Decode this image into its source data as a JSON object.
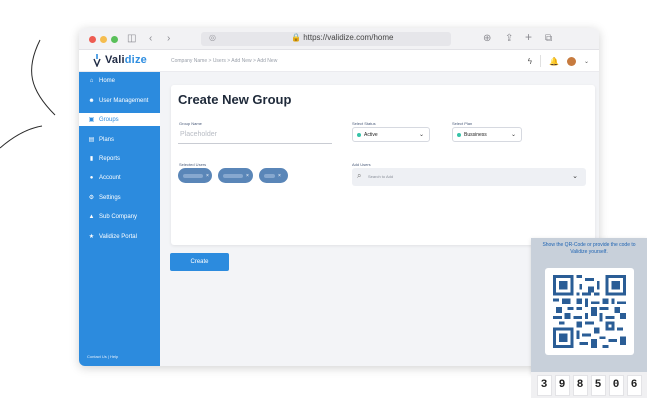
{
  "browser": {
    "url": "https://validize.com/home",
    "icons": {
      "sidebar_toggle": "sidebar-icon",
      "back": "chevron-left-icon",
      "forward": "chevron-right-icon",
      "shield": "shield-icon",
      "lock": "lock-icon",
      "download": "download-icon",
      "share": "share-icon",
      "new_tab": "plus-icon",
      "tabs": "tabs-icon"
    }
  },
  "header": {
    "logo_text_prefix": "Vali",
    "logo_text_accent": "dize",
    "breadcrumb": "Company Name  >  Users  >  Add New  >  Add New",
    "icons": {
      "activity": "activity-icon",
      "bell": "bell-icon",
      "avatar": "avatar",
      "chevron": "chevron-down-icon"
    }
  },
  "sidebar": {
    "items": [
      {
        "label": "Home",
        "icon": "⌂"
      },
      {
        "label": "User Management",
        "icon": "👥"
      },
      {
        "label": "Groups",
        "icon": "▣"
      },
      {
        "label": "Plans",
        "icon": "▤"
      },
      {
        "label": "Reports",
        "icon": "▮"
      },
      {
        "label": "Account",
        "icon": "●"
      },
      {
        "label": "Settings",
        "icon": "⚙"
      },
      {
        "label": "Sub Company",
        "icon": "▲"
      },
      {
        "label": "Validize Portal",
        "icon": "★"
      }
    ],
    "footer": "Contact Us   |   Help"
  },
  "form": {
    "title": "Create New Group",
    "group_name_label": "Group Name",
    "group_name_placeholder": "Placeholder",
    "status_label": "Select Status",
    "status_value": "Active",
    "plan_label": "Select Plan",
    "plan_value": "Bussiness",
    "selected_users_label": "Selected Users",
    "add_users_label": "Add Users",
    "search_placeholder": "Search to Add",
    "chip_remove_symbol": "×",
    "create_button": "Create"
  },
  "colors": {
    "brand": "#2c8bde",
    "status_active": "#36c3a8",
    "chip": "#5a86b8"
  },
  "qr": {
    "instruction": "Show the QR-Code or provide the code to Validize yourself.",
    "digits": [
      "3",
      "9",
      "8",
      "5",
      "0",
      "6"
    ]
  }
}
